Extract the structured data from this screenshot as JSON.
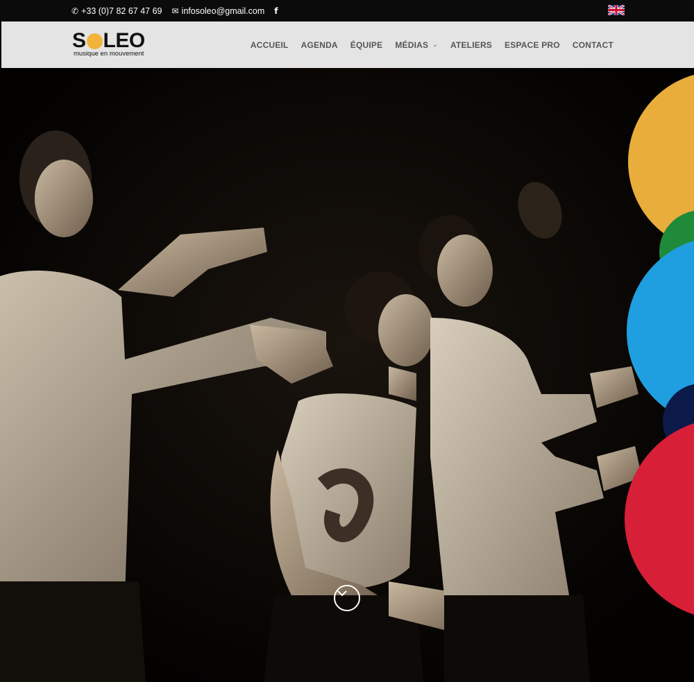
{
  "topbar": {
    "phone_icon": "phone-icon",
    "phone": "+33 (0)7 82 67 47 69",
    "email_icon": "envelope-icon",
    "email": "infosoleo@gmail.com",
    "facebook_icon": "facebook-icon",
    "facebook_glyph": "f",
    "language_icon": "uk-flag-icon"
  },
  "header": {
    "logo": {
      "word_start": "S",
      "word_end": "LEO",
      "tagline": "musique en mouvement"
    },
    "nav": [
      {
        "label": "ACCUEIL"
      },
      {
        "label": "AGENDA"
      },
      {
        "label": "ÉQUIPE"
      },
      {
        "label": "MÉDIAS",
        "dropdown": true
      },
      {
        "label": "ATELIERS"
      },
      {
        "label": "ESPACE PRO"
      },
      {
        "label": "CONTACT"
      }
    ]
  },
  "hero": {
    "image": "black-and-white photo of three performers dancing with outstretched arms",
    "scroll_down_icon": "chevron-down-circle-icon",
    "accent_colors": [
      "#e8ad3b",
      "#1f8a3a",
      "#1f9fe0",
      "#0c1a4a",
      "#d81f38"
    ]
  }
}
